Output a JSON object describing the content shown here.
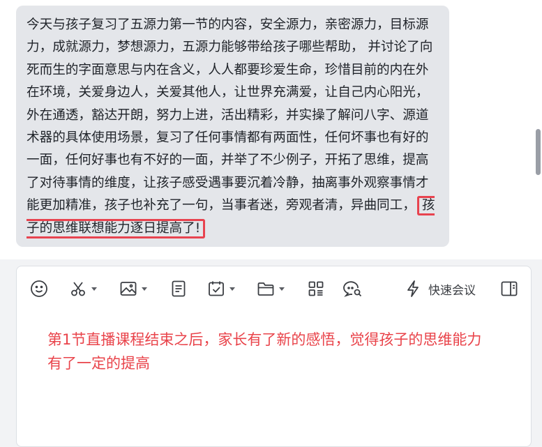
{
  "message": {
    "text_main": "今天与孩子复习了五源力第一节的内容，安全源力，亲密源力，目标源力，成就源力，梦想源力，五源力能够带给孩子哪些帮助， 并讨论了向死而生的字面意思与内在含义，人人都要珍爱生命，珍惜目前的内在外在环境，关爱身边人，关爱其他人，让世界充满爱，让自己内心阳光，外在通透，豁达开朗，努力上进，活出精彩，并实操了解问八字、源道术器的具体使用场景，复习了任何事情都有两面性，任何坏事也有好的一面，任何好事也有不好的一面，并举了不少例子，开拓了思维，提高了对待事情的维度，让孩子感受遇事要沉着冷静，抽离事外观察事情才能更加精准，孩子也补充了一句，当事者迷，旁观者清，异曲同工，",
    "text_highlight": "孩子的思维联想能力逐日提高了!"
  },
  "toolbar": {
    "items": [
      {
        "name": "emoji",
        "icon": "smiley-icon"
      },
      {
        "name": "screenshot",
        "icon": "scissors-icon"
      },
      {
        "name": "image",
        "icon": "image-icon"
      },
      {
        "name": "document",
        "icon": "document-icon"
      },
      {
        "name": "task",
        "icon": "calendar-check-icon"
      },
      {
        "name": "folder",
        "icon": "folder-icon"
      },
      {
        "name": "apps",
        "icon": "grid-icon"
      },
      {
        "name": "chat-search",
        "icon": "chat-search-icon"
      }
    ],
    "quick_meeting_label": "快速会议"
  },
  "editor": {
    "annotation": "第1节直播课程结束之后，家长有了新的感悟，觉得孩子的思维能力有了一定的提高"
  },
  "colors": {
    "highlight_border": "#e8434f",
    "annotation_text": "#e9434a",
    "bubble_bg": "#e4e6ea"
  }
}
